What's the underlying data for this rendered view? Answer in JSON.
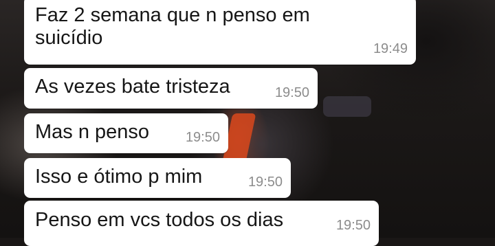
{
  "chat": {
    "messages": [
      {
        "text": "Faz 2 semana que n penso em suicídio",
        "time": "19:49"
      },
      {
        "text": "As vezes bate tristeza",
        "time": "19:50"
      },
      {
        "text": "Mas n penso",
        "time": "19:50"
      },
      {
        "text": "Isso e ótimo p mim",
        "time": "19:50"
      },
      {
        "text": "Penso em vcs todos os dias",
        "time": "19:50"
      }
    ]
  },
  "colors": {
    "bubble_background": "#ffffff",
    "message_text": "#161616",
    "timestamp_text": "#8c8c8c",
    "wallpaper_dark": "#1a1716",
    "wallpaper_accent": "#d9481c"
  }
}
